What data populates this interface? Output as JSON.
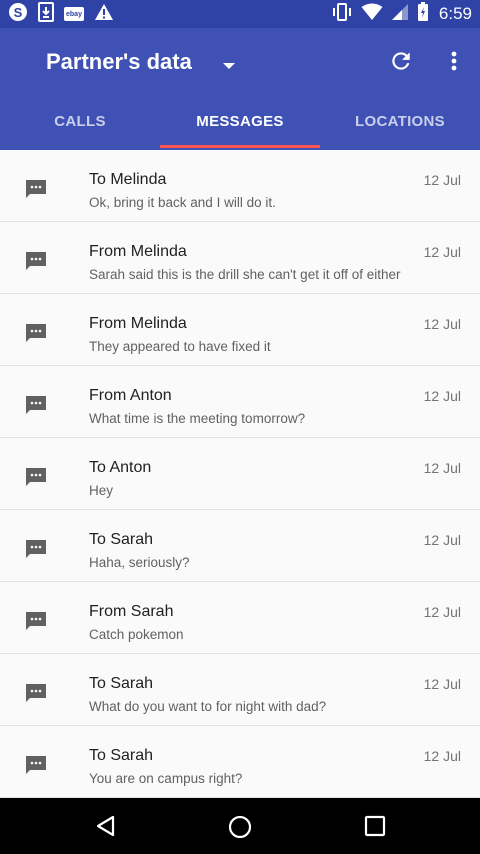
{
  "status_bar": {
    "time": "6:59",
    "icons": [
      "skype-icon",
      "download-icon",
      "ebay-icon",
      "warning-icon",
      "vibrate-icon",
      "wifi-icon",
      "cell-signal-icon",
      "battery-icon"
    ],
    "ebay_text": "ebay"
  },
  "app_bar": {
    "title": "Partner's data",
    "color": "#3f51b5",
    "status_color": "#2f43a7",
    "accent_color": "#ff5252",
    "icons": [
      "dropdown-arrow-icon",
      "refresh-icon",
      "more-vert-icon"
    ]
  },
  "tabs": [
    {
      "label": "CALLS",
      "active": false
    },
    {
      "label": "MESSAGES",
      "active": true
    },
    {
      "label": "LOCATIONS",
      "active": false
    }
  ],
  "messages": [
    {
      "title": "To Melinda",
      "date": "12 Jul",
      "snippet": "Ok, bring it back and I will do it."
    },
    {
      "title": "From Melinda",
      "date": "12 Jul",
      "snippet": "Sarah said this is the drill she can't get it off of either"
    },
    {
      "title": "From Melinda",
      "date": "12 Jul",
      "snippet": "They appeared to have fixed it"
    },
    {
      "title": "From Anton",
      "date": "12 Jul",
      "snippet": "What time is the meeting tomorrow?"
    },
    {
      "title": "To Anton",
      "date": "12 Jul",
      "snippet": "Hey"
    },
    {
      "title": "To Sarah",
      "date": "12 Jul",
      "snippet": "Haha, seriously?"
    },
    {
      "title": "From Sarah",
      "date": "12 Jul",
      "snippet": "Catch pokemon"
    },
    {
      "title": "To Sarah",
      "date": "12 Jul",
      "snippet": "What do you want to for night with dad?"
    },
    {
      "title": "To Sarah",
      "date": "12 Jul",
      "snippet": "You are on campus right?"
    }
  ],
  "message_icon": "message-icon",
  "nav_bar": {
    "icons": [
      "back-icon",
      "home-icon",
      "recents-icon"
    ]
  }
}
